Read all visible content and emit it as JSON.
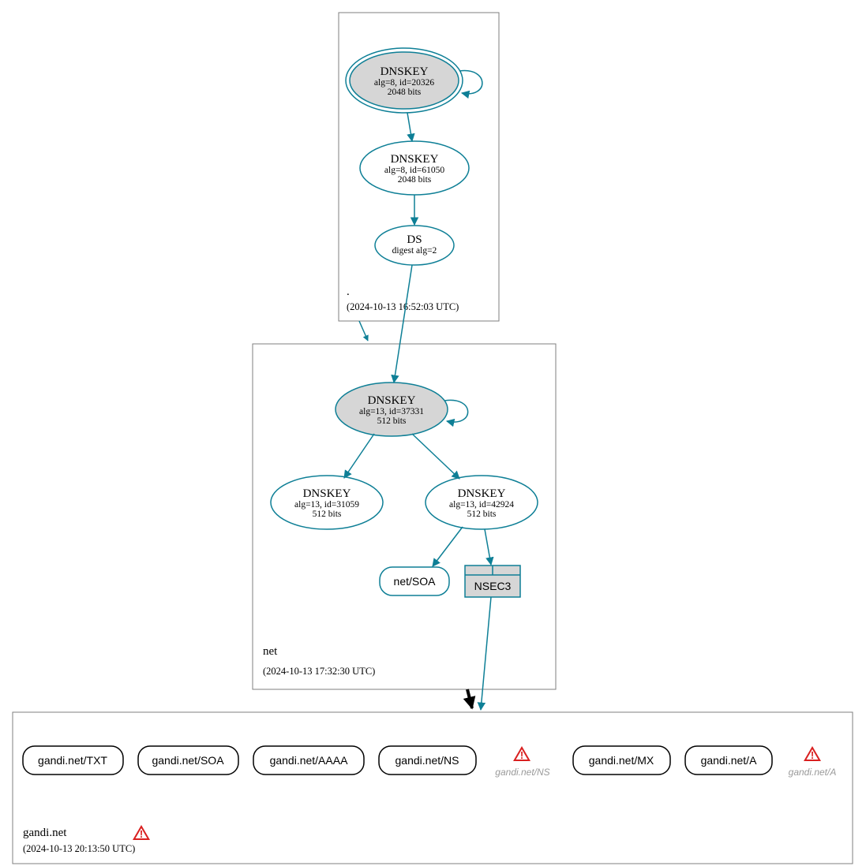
{
  "colors": {
    "teal": "#0e7f96",
    "grey_fill": "#d6d6d6",
    "warn": "#d92020"
  },
  "zones": {
    "root": {
      "label": ".",
      "timestamp": "(2024-10-13 16:52:03 UTC)",
      "nodes": {
        "ksk": {
          "title": "DNSKEY",
          "line2": "alg=8, id=20326",
          "line3": "2048 bits"
        },
        "zsk": {
          "title": "DNSKEY",
          "line2": "alg=8, id=61050",
          "line3": "2048 bits"
        },
        "ds": {
          "title": "DS",
          "line2": "digest alg=2"
        }
      }
    },
    "net": {
      "label": "net",
      "timestamp": "(2024-10-13 17:32:30 UTC)",
      "nodes": {
        "ksk": {
          "title": "DNSKEY",
          "line2": "alg=13, id=37331",
          "line3": "512 bits"
        },
        "zsk1": {
          "title": "DNSKEY",
          "line2": "alg=13, id=31059",
          "line3": "512 bits"
        },
        "zsk2": {
          "title": "DNSKEY",
          "line2": "alg=13, id=42924",
          "line3": "512 bits"
        },
        "soa": {
          "label": "net/SOA"
        },
        "nsec3": {
          "label": "NSEC3"
        }
      }
    },
    "gandi": {
      "label": "gandi.net",
      "timestamp": "(2024-10-13 20:13:50 UTC)",
      "records": {
        "txt": "gandi.net/TXT",
        "soa": "gandi.net/SOA",
        "aaaa": "gandi.net/AAAA",
        "ns": "gandi.net/NS",
        "ns_w": "gandi.net/NS",
        "mx": "gandi.net/MX",
        "a": "gandi.net/A",
        "a_w": "gandi.net/A"
      }
    }
  }
}
